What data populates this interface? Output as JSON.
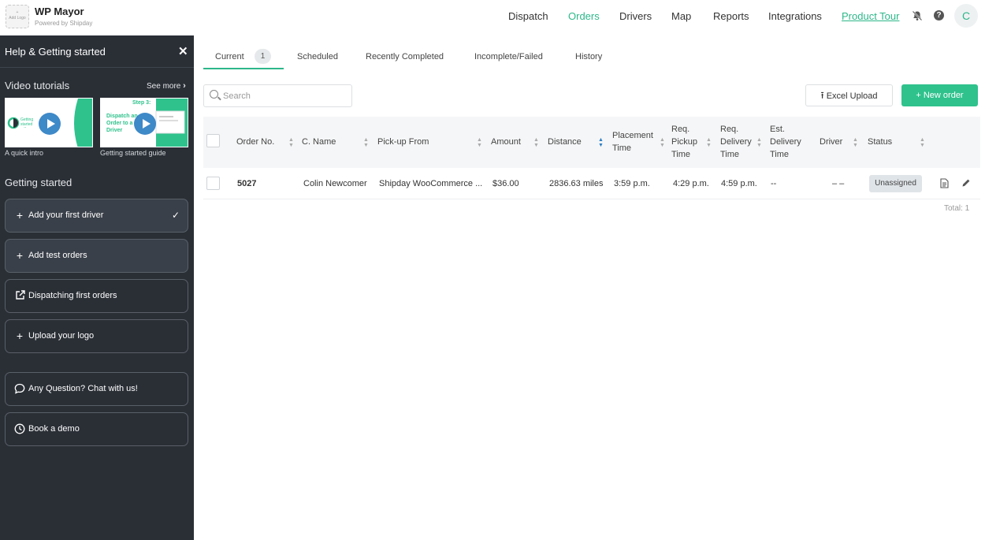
{
  "brand": {
    "title": "WP Mayor",
    "subtitle": "Powered by Shipday",
    "logo_placeholder": "Add Logo"
  },
  "nav": [
    "Dispatch",
    "Orders",
    "Drivers",
    "Map",
    "Reports",
    "Integrations",
    "Product Tour"
  ],
  "nav_active": "Orders",
  "accent_color": "#2db78a",
  "sidebar_bg": "#2a2f36",
  "avatar_initial": "C",
  "sidebar": {
    "title": "Help & Getting started",
    "video_section": "Video tutorials",
    "see_more": "See more",
    "videos": [
      {
        "caption": "A quick intro",
        "thumb_text": "Getting started with Shipday"
      },
      {
        "caption": "Getting started guide",
        "thumb_step": "Step 3:",
        "thumb_text": "Dispatch an Order to a Driver"
      }
    ],
    "getting_started": "Getting started",
    "steps": [
      {
        "label": "Add your first driver",
        "icon": "plus-icon",
        "done": true
      },
      {
        "label": "Add test orders",
        "icon": "plus-icon",
        "done": false
      },
      {
        "label": "Dispatching first orders",
        "icon": "external-link-icon",
        "done": false
      },
      {
        "label": "Upload your logo",
        "icon": "plus-icon",
        "done": false
      }
    ],
    "chat": "Any Question? Chat with us!",
    "demo": "Book a demo"
  },
  "tabs": [
    {
      "label": "Current",
      "count": "1"
    },
    {
      "label": "Scheduled"
    },
    {
      "label": "Recently Completed"
    },
    {
      "label": "Incomplete/Failed"
    },
    {
      "label": "History"
    }
  ],
  "search_placeholder": "Search",
  "excel_upload": "Excel Upload",
  "new_order": "+ New order",
  "columns": [
    "Order No.",
    "C. Name",
    "Pick-up From",
    "Amount",
    "Distance",
    "Placement Time",
    "Req. Pickup Time",
    "Req. Delivery Time",
    "Est. Delivery Time",
    "Driver",
    "Status"
  ],
  "rows": [
    {
      "order_no": "5027",
      "customer": "Colin Newcomer",
      "pickup": "Shipday WooCommerce ...",
      "amount": "$36.00",
      "distance": "2836.63 miles",
      "placement": "3:59 p.m.",
      "req_pickup": "4:29 p.m.",
      "req_delivery": "4:59 p.m.",
      "est_delivery": "--",
      "driver": "– –",
      "status": "Unassigned"
    }
  ],
  "total": "Total: 1"
}
